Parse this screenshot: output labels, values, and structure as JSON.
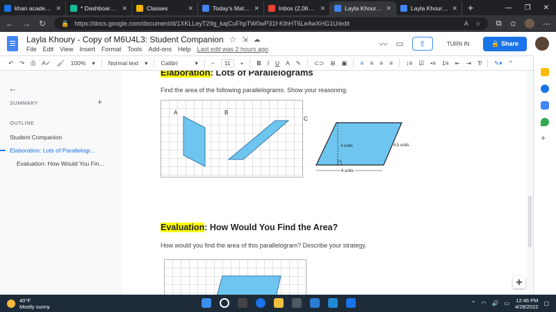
{
  "browser": {
    "tabs": [
      {
        "title": "khan academy - ",
        "color": "#1a73e8",
        "active": false
      },
      {
        "title": "* Dashboard | Kh",
        "color": "#14bf96",
        "active": false
      },
      {
        "title": "Classes",
        "color": "#f4b400",
        "active": false
      },
      {
        "title": "Today's Math As",
        "color": "#4285f4",
        "active": false
      },
      {
        "title": "Inbox (2,067) - la",
        "color": "#ea4335",
        "active": false
      },
      {
        "title": "Layla Khoury - Co",
        "color": "#4285f4",
        "active": true
      },
      {
        "title": "Layla Khoury - Co",
        "color": "#4285f4",
        "active": false
      }
    ],
    "url": "https://docs.google.com/document/d/1XKLLeyT29g_kajCuFhpTW0wP31f-KthHT6LeAwXHG1U/edit"
  },
  "doc": {
    "title": "Layla Khoury - Copy of M6U4L3: Student Companion",
    "menus": [
      "File",
      "Edit",
      "View",
      "Insert",
      "Format",
      "Tools",
      "Add-ons",
      "Help"
    ],
    "last_edit": "Last edit was 2 hours ago",
    "turn_in": "TURN IN",
    "share": "Share"
  },
  "toolbar": {
    "zoom": "100%",
    "style": "Normal text",
    "font": "Calibri",
    "size": "11"
  },
  "outline": {
    "summary": "SUMMARY",
    "outline": "OUTLINE",
    "items": [
      "Student Companion",
      "Elaboration: Lots of Parallelogr...",
      "Evaluation: How Would You Fin..."
    ]
  },
  "content": {
    "elab_highlight": "Elaboration",
    "elab_rest": ": Lots of Parallelograms",
    "elab_text": "Find the area of the following parallelograms. Show your reasoning.",
    "label_a": "A",
    "label_b": "B",
    "label_c": "C",
    "c_height": "4 units",
    "c_side": "4.5 units",
    "c_base": "6 units",
    "eval_highlight": "Evaluation",
    "eval_rest": ": How Would You Find the Area?",
    "eval_text": "How would you find the area of this parallelogram? Describe your strategy."
  },
  "taskbar": {
    "temp": "40°F",
    "weather": "Mostly sunny",
    "time": "12:46 PM",
    "date": "4/28/2022"
  },
  "colors": {
    "accent": "#1a73e8",
    "shape_fill": "#6ec6f0",
    "highlight": "#ffff00"
  }
}
